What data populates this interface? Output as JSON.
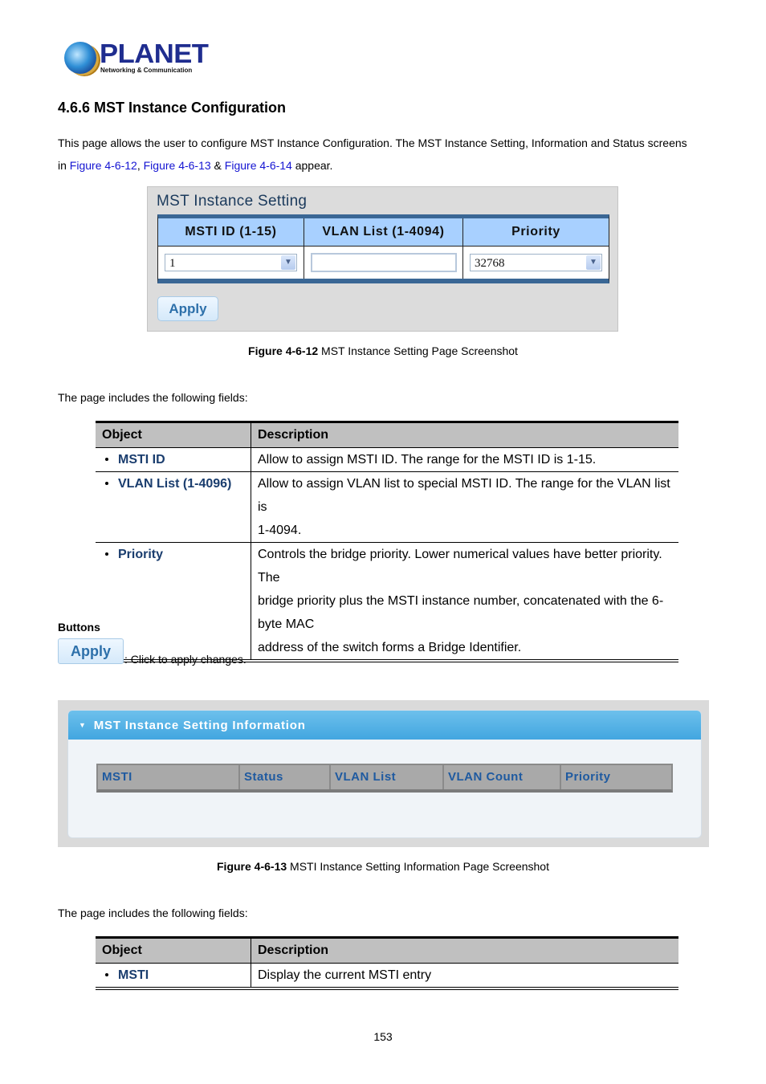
{
  "logo": {
    "brand": "PLANET",
    "tagline": "Networking & Communication"
  },
  "section": {
    "title": "4.6.6 MST Instance Configuration",
    "intro_line1": "This page allows the user to configure MST Instance Configuration. The MST Instance Setting, Information and Status screens",
    "intro_prefix": "in ",
    "link1": "Figure 4-6-12",
    "sep1": ", ",
    "link2": "Figure 4-6-13",
    "sep2": " & ",
    "link3": "Figure 4-6-14",
    "intro_suffix": " appear."
  },
  "figure1": {
    "panel_title": "MST Instance Setting",
    "headers": [
      "MSTI ID (1-15)",
      "VLAN List (1-4094)",
      "Priority"
    ],
    "msti_id_value": "1",
    "vlan_list_value": "",
    "priority_value": "32768",
    "apply_label": "Apply",
    "caption_bold": "Figure 4-6-12",
    "caption_text": " MST Instance Setting Page Screenshot"
  },
  "fields_intro_1": "The page includes the following fields:",
  "table1": {
    "headers": [
      "Object",
      "Description"
    ],
    "rows": [
      {
        "object": "MSTI ID",
        "description": [
          "Allow to assign MSTI ID. The range for the MSTI ID is 1-15."
        ]
      },
      {
        "object": "VLAN List (1-4096)",
        "description": [
          "Allow to assign VLAN list to special MSTI ID. The range for the VLAN list is",
          "1-4094."
        ]
      },
      {
        "object": "Priority",
        "description": [
          "Controls the bridge priority. Lower numerical values have better priority. The",
          "bridge priority plus the MSTI instance number, concatenated with the 6-byte MAC",
          "address of the switch forms a Bridge Identifier."
        ]
      }
    ]
  },
  "buttons_section": {
    "heading": "Buttons",
    "apply_label": "Apply",
    "apply_description": ": Click to apply changes."
  },
  "figure2": {
    "panel_title": "MST Instance Setting Information",
    "headers": [
      "MSTI",
      "Status",
      "VLAN List",
      "VLAN Count",
      "Priority"
    ],
    "caption_bold": "Figure 4-6-13",
    "caption_text": " MSTI Instance Setting Information Page Screenshot"
  },
  "fields_intro_2": "The page includes the following fields:",
  "table2": {
    "headers": [
      "Object",
      "Description"
    ],
    "rows": [
      {
        "object": "MSTI",
        "description": [
          "Display the current MSTI entry"
        ]
      }
    ]
  },
  "page_number": "153"
}
